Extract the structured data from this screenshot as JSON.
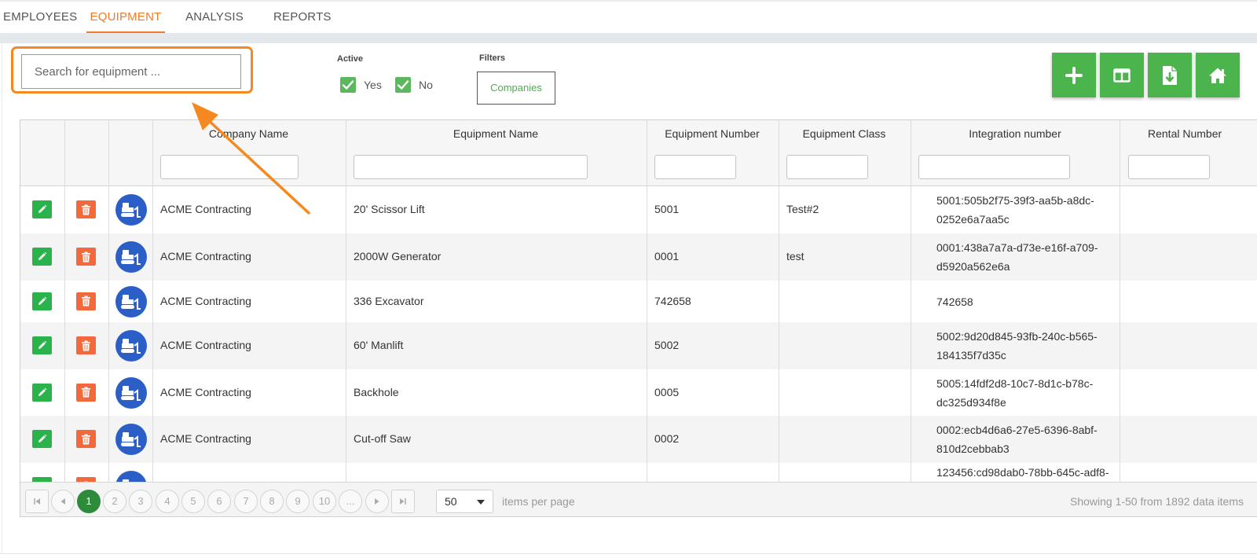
{
  "tabs": [
    {
      "label": "EMPLOYEES",
      "active": false
    },
    {
      "label": "EQUIPMENT",
      "active": true
    },
    {
      "label": "ANALYSIS",
      "active": false
    },
    {
      "label": "REPORTS",
      "active": false
    }
  ],
  "search": {
    "placeholder": "Search for equipment ...",
    "value": ""
  },
  "active_filter": {
    "label": "Active",
    "yes_label": "Yes",
    "yes_checked": true,
    "no_label": "No",
    "no_checked": true
  },
  "filters": {
    "label": "Filters",
    "companies_button": "Companies"
  },
  "toolbar": {
    "buttons": [
      {
        "name": "add-button",
        "icon": "plus-icon"
      },
      {
        "name": "columns-button",
        "icon": "columns-icon"
      },
      {
        "name": "export-button",
        "icon": "file-download-icon"
      },
      {
        "name": "home-button",
        "icon": "home-icon"
      }
    ],
    "color": "#4cb44c"
  },
  "grid": {
    "columns": [
      "",
      "",
      "",
      "Company Name",
      "Equipment Name",
      "Equipment Number",
      "Equipment Class",
      "Integration number",
      "Rental Number"
    ],
    "rows": [
      {
        "company": "ACME Contracting",
        "equipment": "20' Scissor Lift",
        "number": "5001",
        "class": "Test#2",
        "integration": "5001:505b2f75-39f3-aa5b-a8dc-0252e6a7aa5c",
        "rental": ""
      },
      {
        "company": "ACME Contracting",
        "equipment": "2000W Generator",
        "number": "0001",
        "class": "test",
        "integration": "0001:438a7a7a-d73e-e16f-a709-d5920a562e6a",
        "rental": ""
      },
      {
        "company": "ACME Contracting",
        "equipment": "336 Excavator",
        "number": "742658",
        "class": "",
        "integration": "742658",
        "rental": ""
      },
      {
        "company": "ACME Contracting",
        "equipment": "60' Manlift",
        "number": "5002",
        "class": "",
        "integration": "5002:9d20d845-93fb-240c-b565-184135f7d35c",
        "rental": ""
      },
      {
        "company": "ACME Contracting",
        "equipment": "Backhole",
        "number": "0005",
        "class": "",
        "integration": "5005:14fdf2d8-10c7-8d1c-b78c-dc325d934f8e",
        "rental": ""
      },
      {
        "company": "ACME Contracting",
        "equipment": "Cut-off Saw",
        "number": "0002",
        "class": "",
        "integration": "0002:ecb4d6a6-27e5-6396-8abf-810d2cebbab3",
        "rental": ""
      },
      {
        "company": "",
        "equipment": "",
        "number": "",
        "class": "",
        "integration": "123456:cd98dab0-78bb-645c-adf8-",
        "rental": ""
      }
    ]
  },
  "pager": {
    "pages": [
      "1",
      "2",
      "3",
      "4",
      "5",
      "6",
      "7",
      "8",
      "9",
      "10",
      "..."
    ],
    "current_page": "1",
    "per_page": "50",
    "per_page_label": "items per page",
    "summary": "Showing 1-50 from 1892 data items"
  },
  "colors": {
    "accent": "#f07b29",
    "green": "#4cb44c",
    "edit": "#29b34a",
    "delete": "#f26a3c",
    "avatar": "#2b5fc7",
    "annotation": "#f5891f"
  }
}
